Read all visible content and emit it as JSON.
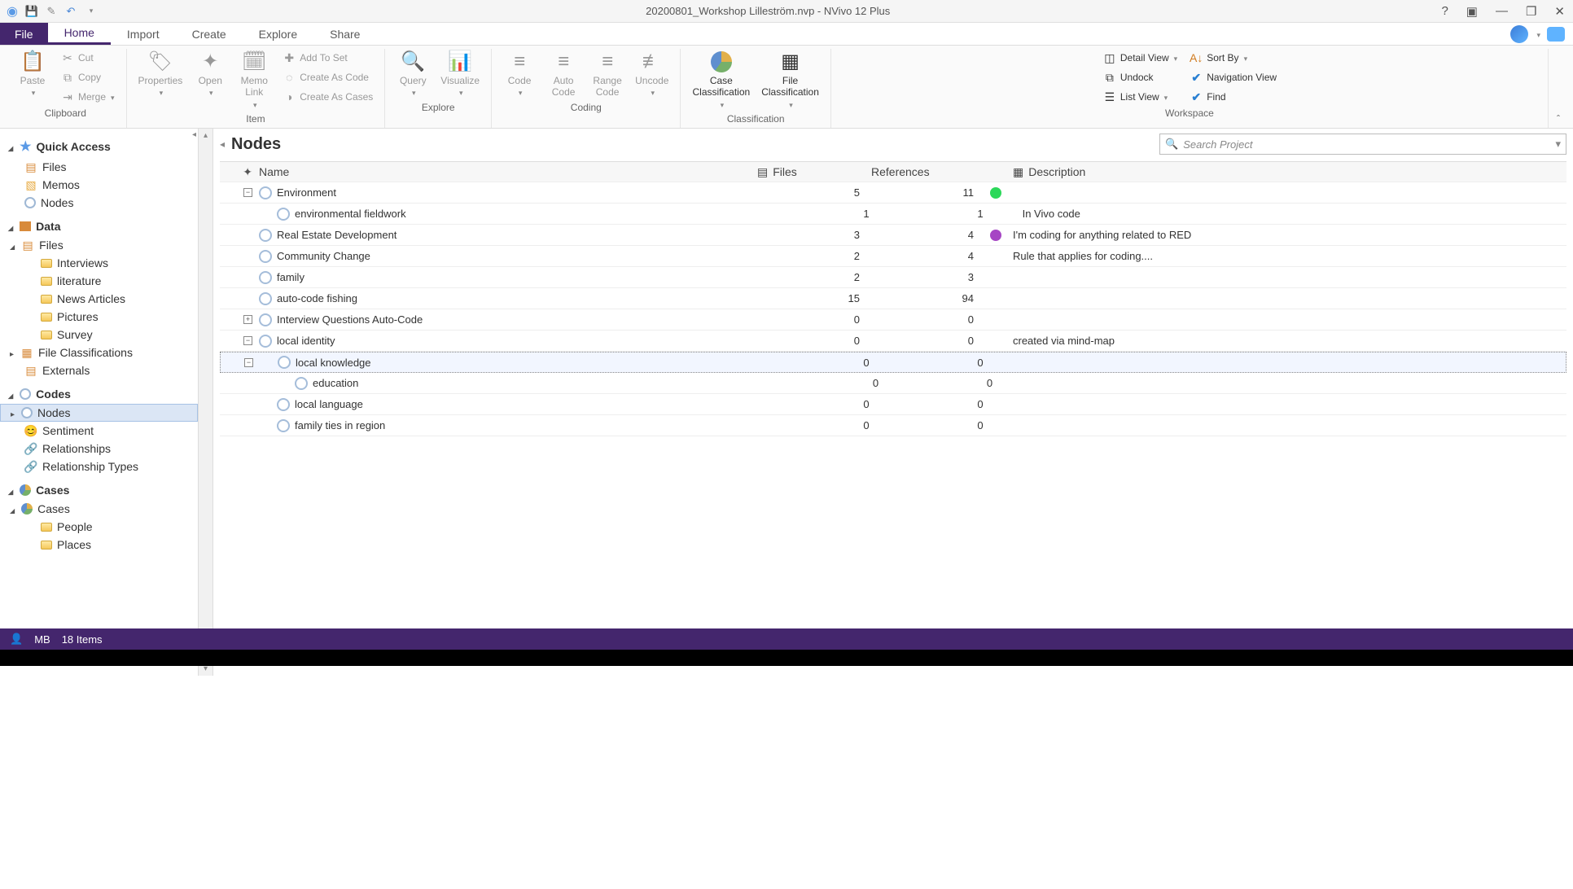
{
  "title": "20200801_Workshop Lilleström.nvp - NVivo 12 Plus",
  "tabs": {
    "file": "File",
    "home": "Home",
    "import": "Import",
    "create": "Create",
    "explore": "Explore",
    "share": "Share"
  },
  "ribbon": {
    "clipboard": {
      "label": "Clipboard",
      "paste": "Paste",
      "cut": "Cut",
      "copy": "Copy",
      "merge": "Merge"
    },
    "item": {
      "label": "Item",
      "properties": "Properties",
      "open": "Open",
      "memo_link": "Memo\nLink",
      "add_to_set": "Add To Set",
      "create_as_code": "Create As Code",
      "create_as_cases": "Create As Cases"
    },
    "explore": {
      "label": "Explore",
      "query": "Query",
      "visualize": "Visualize"
    },
    "coding": {
      "label": "Coding",
      "code": "Code",
      "auto_code": "Auto\nCode",
      "range_code": "Range\nCode",
      "uncode": "Uncode"
    },
    "classification": {
      "label": "Classification",
      "case": "Case\nClassification",
      "file": "File\nClassification"
    },
    "workspace": {
      "label": "Workspace",
      "detail_view": "Detail View",
      "sort_by": "Sort By",
      "undock": "Undock",
      "navigation_view": "Navigation View",
      "list_view": "List View",
      "find": "Find"
    }
  },
  "nav": {
    "quick_access": {
      "label": "Quick Access",
      "files": "Files",
      "memos": "Memos",
      "nodes": "Nodes"
    },
    "data": {
      "label": "Data",
      "files": "Files",
      "interviews": "Interviews",
      "literature": "literature",
      "news": "News Articles",
      "pictures": "Pictures",
      "survey": "Survey",
      "file_class": "File Classifications",
      "externals": "Externals"
    },
    "codes": {
      "label": "Codes",
      "nodes": "Nodes",
      "sentiment": "Sentiment",
      "relationships": "Relationships",
      "rel_types": "Relationship Types"
    },
    "cases": {
      "label": "Cases",
      "cases": "Cases",
      "people": "People",
      "places": "Places"
    }
  },
  "content": {
    "title": "Nodes",
    "search_placeholder": "Search Project",
    "columns": {
      "name": "Name",
      "files": "Files",
      "refs": "References",
      "desc": "Description"
    },
    "rows": [
      {
        "exp": "−",
        "indent": 0,
        "name": "Environment",
        "files": "5",
        "refs": "11",
        "color": "#2cd85a",
        "desc": ""
      },
      {
        "exp": "",
        "indent": 1,
        "name": "environmental fieldwork",
        "files": "1",
        "refs": "1",
        "color": "",
        "desc": "In Vivo code"
      },
      {
        "exp": "",
        "indent": 0,
        "name": "Real Estate Development",
        "files": "3",
        "refs": "4",
        "color": "#a646c4",
        "desc": "I'm coding for anything related to RED"
      },
      {
        "exp": "",
        "indent": 0,
        "name": "Community Change",
        "files": "2",
        "refs": "4",
        "color": "",
        "desc": "Rule that applies for coding...."
      },
      {
        "exp": "",
        "indent": 0,
        "name": "family",
        "files": "2",
        "refs": "3",
        "color": "",
        "desc": ""
      },
      {
        "exp": "",
        "indent": 0,
        "name": "auto-code fishing",
        "files": "15",
        "refs": "94",
        "color": "",
        "desc": ""
      },
      {
        "exp": "+",
        "indent": 0,
        "name": "Interview Questions Auto-Code",
        "files": "0",
        "refs": "0",
        "color": "",
        "desc": ""
      },
      {
        "exp": "−",
        "indent": 0,
        "name": "local identity",
        "files": "0",
        "refs": "0",
        "color": "",
        "desc": "created via  mind-map"
      },
      {
        "exp": "−",
        "indent": 1,
        "name": "local knowledge",
        "files": "0",
        "refs": "0",
        "color": "",
        "desc": "",
        "selected": true
      },
      {
        "exp": "",
        "indent": 2,
        "name": "education",
        "files": "0",
        "refs": "0",
        "color": "",
        "desc": ""
      },
      {
        "exp": "",
        "indent": 1,
        "name": "local language",
        "files": "0",
        "refs": "0",
        "color": "",
        "desc": ""
      },
      {
        "exp": "",
        "indent": 1,
        "name": "family ties in region",
        "files": "0",
        "refs": "0",
        "color": "",
        "desc": ""
      }
    ]
  },
  "status": {
    "user": "MB",
    "items": "18 Items"
  }
}
